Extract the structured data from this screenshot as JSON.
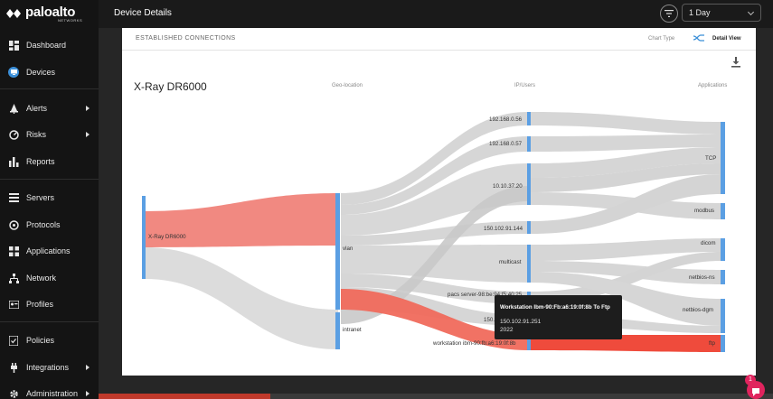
{
  "brand": {
    "name": "paloalto",
    "sub": "NETWORKS"
  },
  "header": {
    "title": "Device Details",
    "period": "1 Day"
  },
  "sidebar": {
    "items": [
      {
        "label": "Dashboard",
        "icon": "dashboard-icon"
      },
      {
        "label": "Devices",
        "icon": "devices-icon",
        "active": true
      },
      {
        "label": "Alerts",
        "icon": "alerts-icon",
        "submenu": true
      },
      {
        "label": "Risks",
        "icon": "risks-icon",
        "submenu": true
      },
      {
        "label": "Reports",
        "icon": "reports-icon"
      },
      {
        "label": "Servers",
        "icon": "servers-icon"
      },
      {
        "label": "Protocols",
        "icon": "protocols-icon"
      },
      {
        "label": "Applications",
        "icon": "applications-icon"
      },
      {
        "label": "Network",
        "icon": "network-icon"
      },
      {
        "label": "Profiles",
        "icon": "profiles-icon"
      },
      {
        "label": "Policies",
        "icon": "policies-icon"
      },
      {
        "label": "Integrations",
        "icon": "integrations-icon",
        "submenu": true
      },
      {
        "label": "Administration",
        "icon": "administration-icon",
        "submenu": true
      }
    ]
  },
  "card": {
    "section_title": "ESTABLISHED CONNECTIONS",
    "chart_type_label": "Chart Type",
    "detail_view": "Detail View",
    "device_title": "X-Ray DR6000",
    "columns": {
      "geo": "Geo-location",
      "ip": "IP/Users",
      "apps": "Applications"
    }
  },
  "sankey": {
    "source": "X-Ray DR6000",
    "geo": [
      "vlan",
      "intranet"
    ],
    "ip": [
      "192.168.0.56",
      "192.168.0.57",
      "10.10.37.20",
      "150.102.91.144",
      "multicast",
      "pacs server-98:be:94:f5:40:25",
      "150.1",
      "workstation ibm-90:fb:a6:19:0f:8b"
    ],
    "apps": [
      "TCP",
      "modbus",
      "dicom",
      "netbios-ns",
      "netbios-dgm",
      "ftp"
    ]
  },
  "tooltip": {
    "title": "Workstation Ibm-90:Fb:a6:19:0f:8b To Ftp",
    "line1": "150.102.91.251",
    "line2": "2022"
  },
  "chat": {
    "badge": "1"
  },
  "colors": {
    "accent": "#3b8fd8",
    "highlight": "#ef5a4a",
    "link": "#cfcfcf",
    "node": "#5b9fe3"
  }
}
